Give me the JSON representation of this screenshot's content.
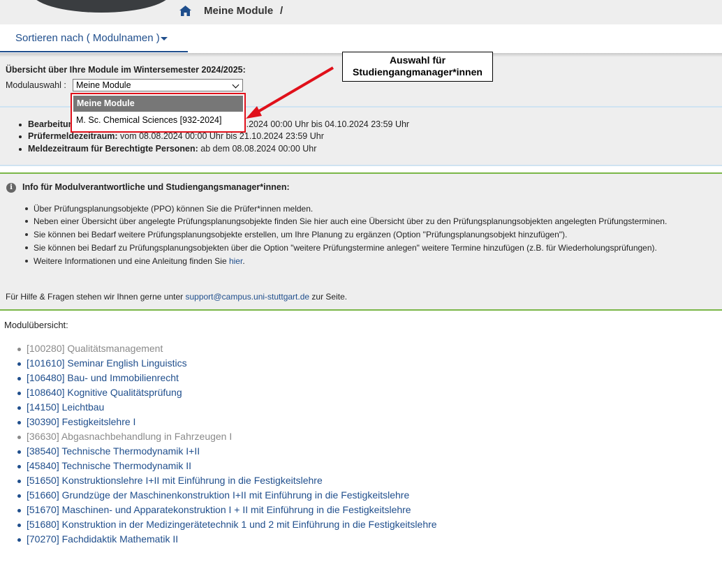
{
  "header": {
    "breadcrumb_label": "Meine Module",
    "breadcrumb_sep": "/"
  },
  "sort": {
    "label": "Sortieren nach ( Modulnamen )"
  },
  "overview": {
    "title": "Übersicht über Ihre Module im Wintersemester 2024/2025:",
    "select_label": "Modulauswahl :",
    "select_value": "Meine Module",
    "options": [
      "Meine Module",
      "M. Sc. Chemical Sciences [932-2024]"
    ]
  },
  "periods": [
    {
      "label": "Bearbeitungszeitraum der Prüfungsdauer:",
      "value": " vom 08.08.2024 00:00 Uhr bis 04.10.2024 23:59 Uhr"
    },
    {
      "label": "Prüfermeldezeitraum:",
      "value": " vom 08.08.2024 00:00 Uhr bis 21.10.2024 23:59 Uhr"
    },
    {
      "label": "Meldezeitraum für Berechtigte Personen:",
      "value": " ab dem 08.08.2024 00:00 Uhr"
    }
  ],
  "info": {
    "title": "Info für Modulverantwortliche und Studiengangsmanager*innen:",
    "items": [
      "Über Prüfungsplanungsobjekte (PPO) können Sie die Prüfer*innen melden.",
      "Neben einer Übersicht über angelegte Prüfungsplanungsobjekte finden Sie hier auch eine Übersicht über zu den Prüfungsplanungsobjekten angelegten Prüfungsterminen.",
      "Sie können bei Bedarf weitere Prüfungsplanungsobjekte erstellen, um Ihre Planung zu ergänzen (Option \"Prüfungsplanungsobjekt hinzufügen\").",
      "Sie können bei Bedarf zu Prüfungsplanungsobjekten über die Option \"weitere Prüfungstermine anlegen\" weitere Termine hinzufügen (z.B. für Wiederholungsprüfungen).",
      "Weitere Informationen und eine Anleitung finden Sie "
    ],
    "link_text": "hier",
    "link_suffix": "."
  },
  "help": {
    "prefix": "Für Hilfe & Fragen stehen wir Ihnen gerne unter ",
    "email": "support@campus.uni-stuttgart.de",
    "suffix": " zur Seite."
  },
  "modules": {
    "title": "Modulübersicht:",
    "items": [
      "[100280] Qualitätsmanagement",
      "[101610] Seminar English Linguistics",
      "[106480] Bau- und Immobilienrecht",
      "[108640] Kognitive Qualitätsprüfung",
      "[14150] Leichtbau",
      "[30390] Festigkeitslehre I",
      "[36630] Abgasnachbehandlung in Fahrzeugen I",
      "[38540] Technische Thermodynamik I+II",
      "[45840] Technische Thermodynamik II",
      "[51650] Konstruktionslehre I+II mit Einführung in die Festigkeitslehre",
      "[51660] Grundzüge der Maschinenkonstruktion I+II mit Einführung in die Festigkeitslehre",
      "[51670] Maschinen- und Apparatekonstruktion I + II mit Einführung in die Festigkeitslehre",
      "[51680] Konstruktion in der Medizingerätetechnik 1 und 2 mit Einführung in die Festigkeitslehre",
      "[70270] Fachdidaktik Mathematik II"
    ]
  },
  "callout": {
    "line1": "Auswahl für",
    "line2": "Studiengangmanager*innen"
  },
  "icons": {
    "home": "home-icon",
    "info": "info-icon",
    "caret": "caret-down-icon"
  }
}
